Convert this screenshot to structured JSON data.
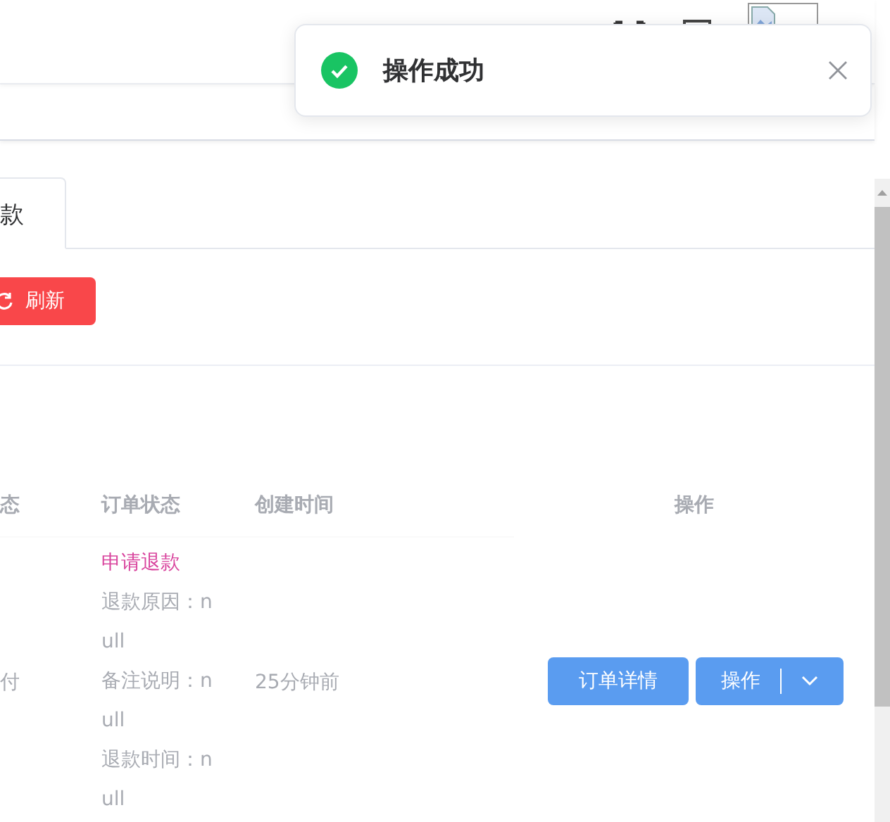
{
  "toast": {
    "message": "操作成功",
    "kind": "success"
  },
  "tab": {
    "label": "款",
    "selected": true
  },
  "toolbar": {
    "refresh": "刷新"
  },
  "table": {
    "columns": [
      "态",
      "订单状态",
      "创建时间",
      "操作"
    ],
    "rows": [
      {
        "pay_status": "付",
        "order_status": "申请退款",
        "details": [
          "退款原因：null",
          "备注说明：null",
          "退款时间：null"
        ],
        "created": "25分钟前",
        "actions": {
          "detail": "订单详情",
          "more": "操作"
        }
      }
    ]
  }
}
